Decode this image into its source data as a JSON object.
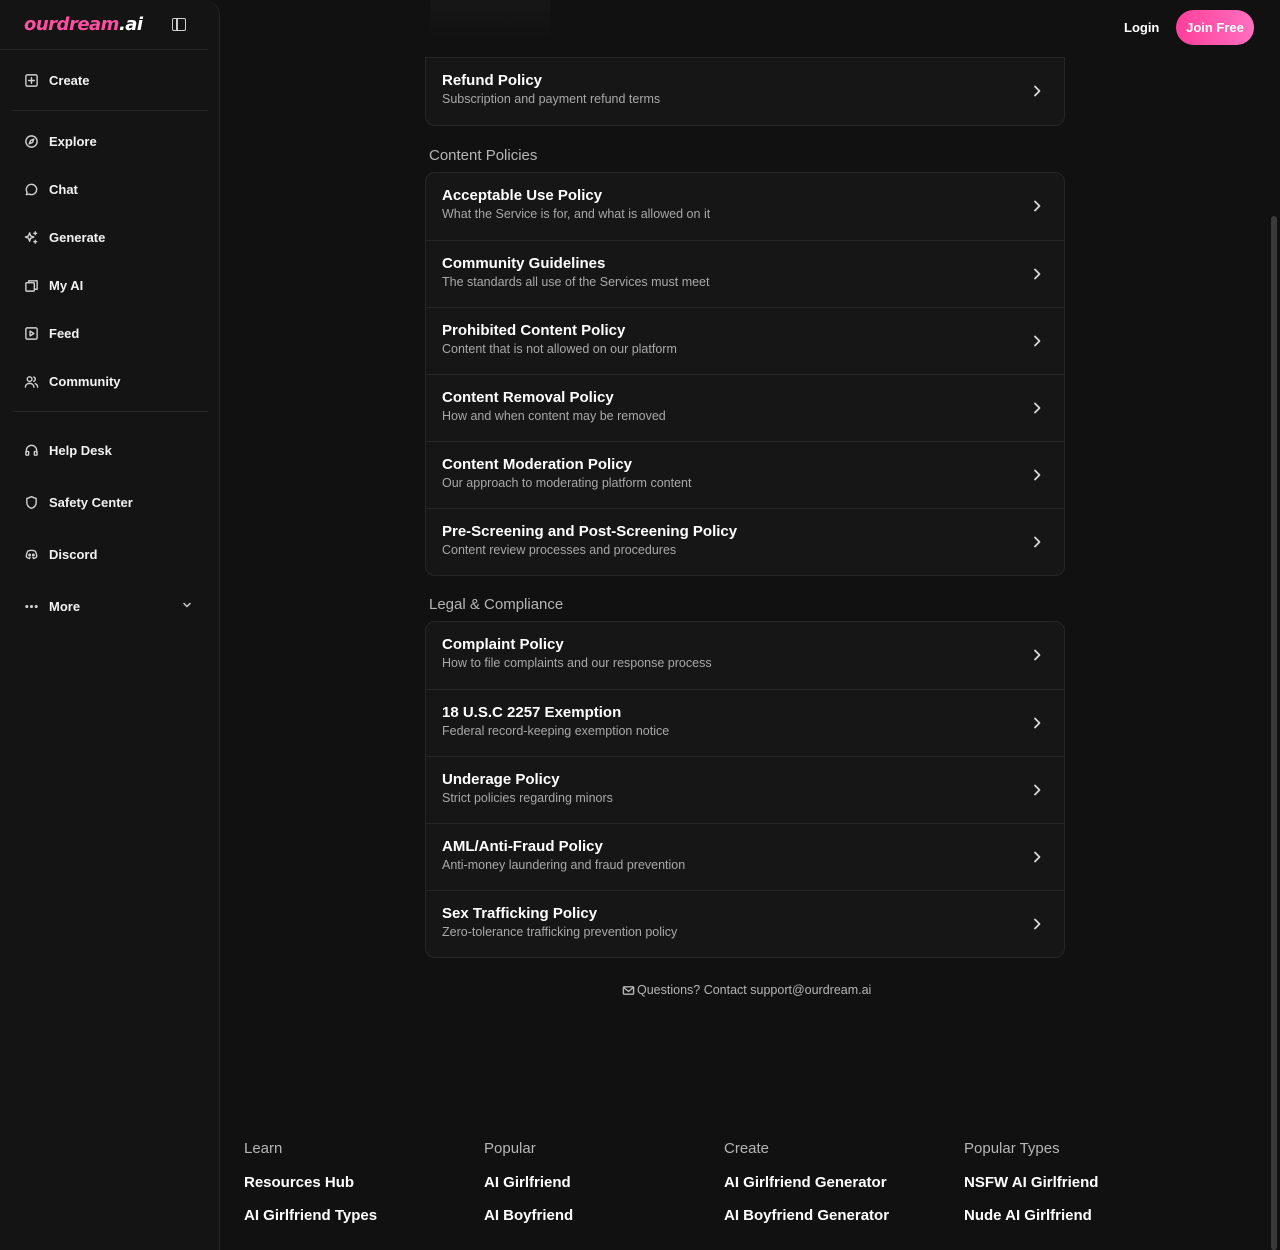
{
  "brand": {
    "logo_part1": "ourdream",
    "logo_part2": ".ai"
  },
  "header": {
    "login": "Login",
    "join": "Join Free"
  },
  "sidebar": {
    "create": "Create",
    "explore": "Explore",
    "chat": "Chat",
    "generate": "Generate",
    "my_ai": "My AI",
    "feed": "Feed",
    "community": "Community",
    "help_desk": "Help Desk",
    "safety_center": "Safety Center",
    "discord": "Discord",
    "more": "More"
  },
  "policies": {
    "top_group": [
      {
        "title": "Refund Policy",
        "subtitle": "Subscription and payment refund terms"
      }
    ],
    "content_label": "Content Policies",
    "content": [
      {
        "title": "Acceptable Use Policy",
        "subtitle": "What the Service is for, and what is allowed on it"
      },
      {
        "title": "Community Guidelines",
        "subtitle": "The standards all use of the Services must meet"
      },
      {
        "title": "Prohibited Content Policy",
        "subtitle": "Content that is not allowed on our platform"
      },
      {
        "title": "Content Removal Policy",
        "subtitle": "How and when content may be removed"
      },
      {
        "title": "Content Moderation Policy",
        "subtitle": "Our approach to moderating platform content"
      },
      {
        "title": "Pre-Screening and Post-Screening Policy",
        "subtitle": "Content review processes and procedures"
      }
    ],
    "legal_label": "Legal & Compliance",
    "legal": [
      {
        "title": "Complaint Policy",
        "subtitle": "How to file complaints and our response process"
      },
      {
        "title": "18 U.S.C 2257 Exemption",
        "subtitle": "Federal record-keeping exemption notice"
      },
      {
        "title": "Underage Policy",
        "subtitle": "Strict policies regarding minors"
      },
      {
        "title": "AML/Anti-Fraud Policy",
        "subtitle": "Anti-money laundering and fraud prevention"
      },
      {
        "title": "Sex Trafficking Policy",
        "subtitle": "Zero-tolerance trafficking prevention policy"
      }
    ]
  },
  "contact": "Questions? Contact support@ourdream.ai",
  "footer": {
    "learn": {
      "head": "Learn",
      "links": [
        "Resources Hub",
        "AI Girlfriend Types"
      ]
    },
    "popular": {
      "head": "Popular",
      "links": [
        "AI Girlfriend",
        "AI Boyfriend"
      ]
    },
    "create": {
      "head": "Create",
      "links": [
        "AI Girlfriend Generator",
        "AI Boyfriend Generator"
      ]
    },
    "types": {
      "head": "Popular Types",
      "links": [
        "NSFW AI Girlfriend",
        "Nude AI Girlfriend"
      ]
    }
  }
}
